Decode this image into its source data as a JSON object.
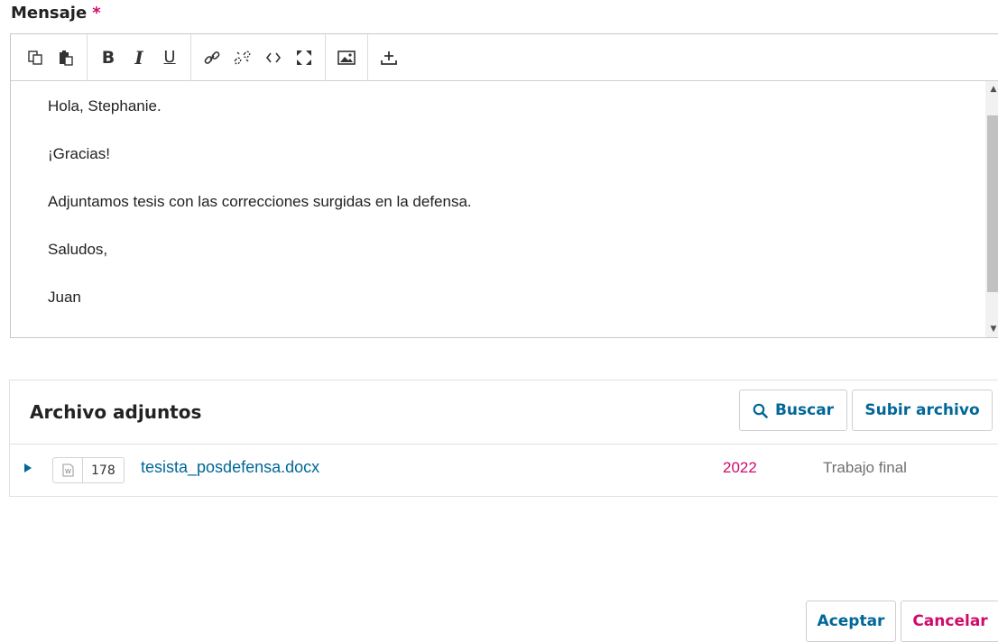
{
  "form": {
    "label": "Mensaje",
    "required_mark": "*"
  },
  "editor": {
    "toolbar": [
      {
        "name": "copy-icon"
      },
      {
        "name": "paste-icon"
      },
      {
        "name": "bold-icon",
        "glyph": "B"
      },
      {
        "name": "italic-icon",
        "glyph": "I"
      },
      {
        "name": "underline-icon",
        "glyph": "U"
      },
      {
        "name": "link-icon"
      },
      {
        "name": "unlink-icon"
      },
      {
        "name": "code-icon"
      },
      {
        "name": "fullscreen-icon"
      },
      {
        "name": "image-icon"
      },
      {
        "name": "upload-icon"
      }
    ],
    "paragraphs": [
      "Hola, Stephanie.",
      "¡Gracias!",
      "Adjuntamos tesis con las correcciones surgidas en la defensa.",
      "Saludos,",
      "Juan"
    ]
  },
  "attachments": {
    "title": "Archivo adjuntos",
    "search_label": "Buscar",
    "upload_label": "Subir archivo",
    "files": [
      {
        "id": "178",
        "name": "tesista_posdefensa.docx",
        "year": "2022",
        "type": "Trabajo final"
      }
    ]
  },
  "actions": {
    "accept_label": "Aceptar",
    "cancel_label": "Cancelar"
  },
  "colors": {
    "link": "#006798",
    "accent": "#d00a6c"
  }
}
